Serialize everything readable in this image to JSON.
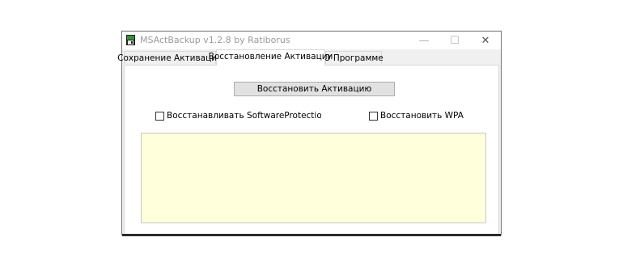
{
  "window": {
    "title": "MSActBackup v1.2.8 by Ratiborus"
  },
  "titlebar": {
    "minimize_glyph": "—",
    "maximize_glyph": "☐",
    "close_glyph": "✕"
  },
  "tabs": [
    {
      "label": "Сохранение Активации",
      "active": false
    },
    {
      "label": "Восстановление Активации",
      "active": true
    },
    {
      "label": "О Программе",
      "active": false
    }
  ],
  "main": {
    "restore_button_label": "Восстановить Активацию",
    "checkbox_spp": {
      "label": "Восстанавливать SoftwareProtectionPlatform",
      "checked": false
    },
    "checkbox_wpa": {
      "label": "Восстановить WPA",
      "checked": false
    },
    "log_text": ""
  },
  "colors": {
    "log_background": "#ffffdc",
    "button_background": "#e1e1e1",
    "window_background": "#f0f0f0"
  }
}
